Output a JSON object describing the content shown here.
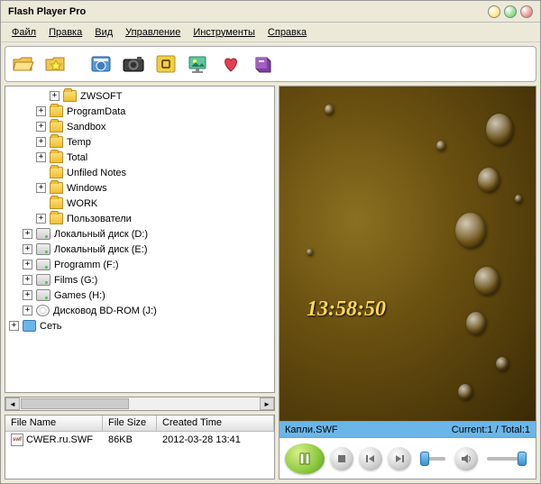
{
  "window": {
    "title": "Flash Player Pro"
  },
  "menu": [
    "Файл",
    "Правка",
    "Вид",
    "Управление",
    "Инструменты",
    "Справка"
  ],
  "tree": [
    {
      "indent": 3,
      "toggle": "+",
      "icon": "folder",
      "label": "ZWSOFT"
    },
    {
      "indent": 2,
      "toggle": "+",
      "icon": "folder",
      "label": "ProgramData"
    },
    {
      "indent": 2,
      "toggle": "+",
      "icon": "folder",
      "label": "Sandbox"
    },
    {
      "indent": 2,
      "toggle": "+",
      "icon": "folder",
      "label": "Temp"
    },
    {
      "indent": 2,
      "toggle": "+",
      "icon": "folder",
      "label": "Total"
    },
    {
      "indent": 2,
      "toggle": " ",
      "icon": "folder",
      "label": "Unfiled Notes"
    },
    {
      "indent": 2,
      "toggle": "+",
      "icon": "folder",
      "label": "Windows"
    },
    {
      "indent": 2,
      "toggle": " ",
      "icon": "folder",
      "label": "WORK"
    },
    {
      "indent": 2,
      "toggle": "+",
      "icon": "folder",
      "label": "Пользователи"
    },
    {
      "indent": 1,
      "toggle": "+",
      "icon": "drive",
      "label": "Локальный диск (D:)"
    },
    {
      "indent": 1,
      "toggle": "+",
      "icon": "drive",
      "label": "Локальный диск (E:)"
    },
    {
      "indent": 1,
      "toggle": "+",
      "icon": "drive",
      "label": "Programm (F:)"
    },
    {
      "indent": 1,
      "toggle": "+",
      "icon": "drive",
      "label": "Films (G:)"
    },
    {
      "indent": 1,
      "toggle": "+",
      "icon": "drive",
      "label": "Games (H:)"
    },
    {
      "indent": 1,
      "toggle": "+",
      "icon": "cd",
      "label": "Дисковод BD-ROM (J:)"
    },
    {
      "indent": 0,
      "toggle": "+",
      "icon": "net",
      "label": "Сеть"
    }
  ],
  "fileTable": {
    "headers": [
      "File Name",
      "File Size",
      "Created Time"
    ],
    "row": {
      "name": "CWER.ru.SWF",
      "size": "86KB",
      "time": "2012-03-28 13:41"
    }
  },
  "preview": {
    "clock": "13:58:50",
    "filename": "Капли.SWF",
    "counter": "Current:1 / Total:1"
  }
}
